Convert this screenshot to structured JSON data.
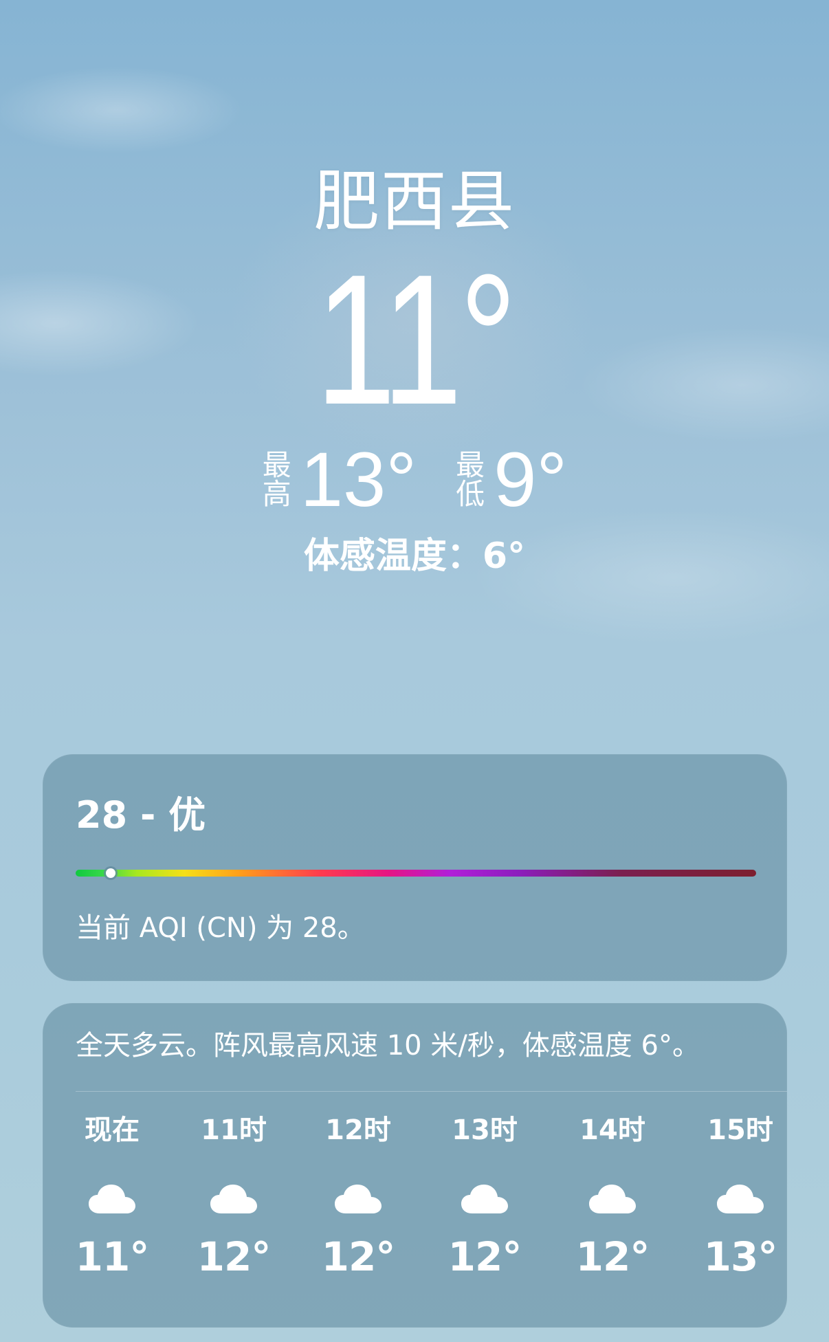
{
  "weather": {
    "location": "肥西县",
    "current_temp": "11°",
    "high_label": "最高",
    "high_temp": "13°",
    "low_label": "最低",
    "low_temp": "9°",
    "feels_like": "体感温度：6°"
  },
  "aqi": {
    "title": "28 - 优",
    "description": "当前 AQI (CN) 为 28。",
    "level_fraction": 0.052,
    "colors": [
      "#10c940",
      "#a8e81f",
      "#f6df18",
      "#ff9f1a",
      "#ff3b4e",
      "#e51583",
      "#b11fd8",
      "#7b1f4f",
      "#7d1f2f"
    ]
  },
  "forecast": {
    "summary": "全天多云。阵风最高风速 10 米/秒，体感温度 6°。",
    "hours": [
      {
        "label": "现在",
        "icon": "cloud-icon",
        "temp": "11°"
      },
      {
        "label": "11时",
        "icon": "cloud-icon",
        "temp": "12°"
      },
      {
        "label": "12时",
        "icon": "cloud-icon",
        "temp": "12°"
      },
      {
        "label": "13时",
        "icon": "cloud-icon",
        "temp": "12°"
      },
      {
        "label": "14时",
        "icon": "cloud-icon",
        "temp": "12°"
      },
      {
        "label": "15时",
        "icon": "cloud-icon",
        "temp": "13°"
      }
    ]
  },
  "theme": {
    "sky_top": "#86b4d3",
    "sky_bottom": "#afcfdc",
    "card_color": "#60899e"
  }
}
